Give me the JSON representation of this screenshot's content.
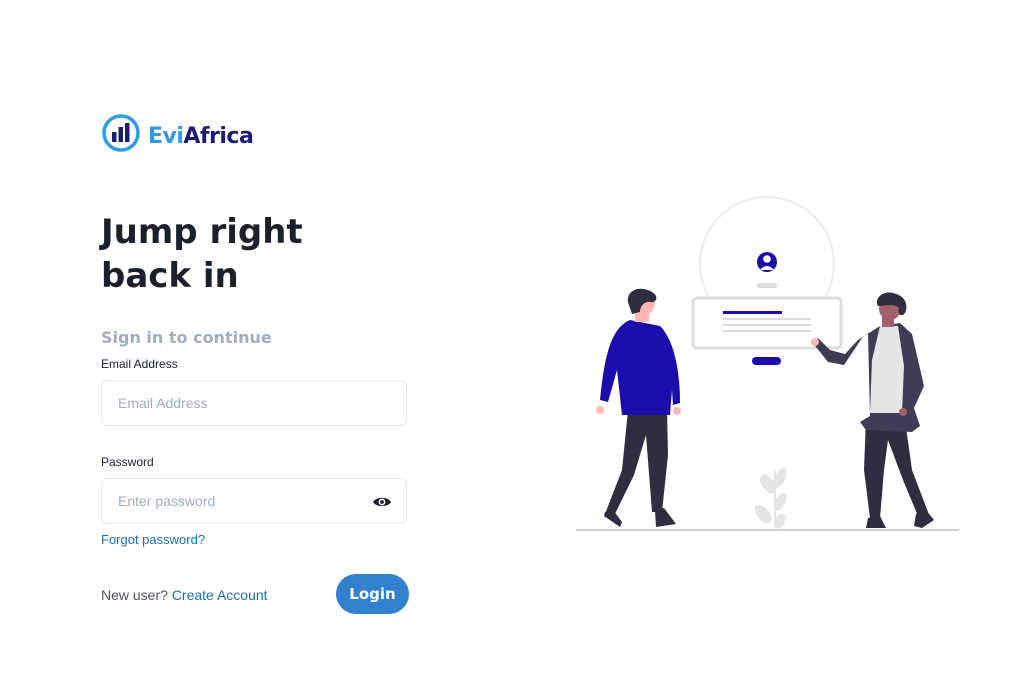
{
  "brand": {
    "part1": "Evi",
    "part2": "Africa",
    "icon": "bar-chart-logo-icon"
  },
  "heading": "Jump right back in",
  "subheading": "Sign in to continue",
  "email": {
    "label": "Email Address",
    "placeholder": "Email Address",
    "value": ""
  },
  "password": {
    "label": "Password",
    "placeholder": "Enter password",
    "value": "",
    "toggle_icon": "eye-icon"
  },
  "forgot_link": "Forgot password?",
  "signup": {
    "prompt": "New user?",
    "link": "Create Account"
  },
  "login_button": "Login",
  "colors": {
    "primary": "#3182ce",
    "brand_blue": "#2e9be6",
    "brand_navy": "#1c1c73",
    "link": "#1a6fb5",
    "illustration_accent": "#1a0dab"
  }
}
